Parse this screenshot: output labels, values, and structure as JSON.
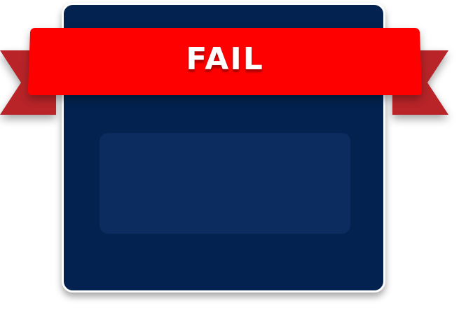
{
  "result_banner": {
    "label": "FAIL"
  },
  "colors": {
    "panel_background": "#03224f",
    "inner_box": "#0c2b5e",
    "ribbon": "#ff0000",
    "ribbon_tail": "#b82428",
    "ribbon_fold": "#7d1519",
    "panel_border": "#ffffff"
  }
}
